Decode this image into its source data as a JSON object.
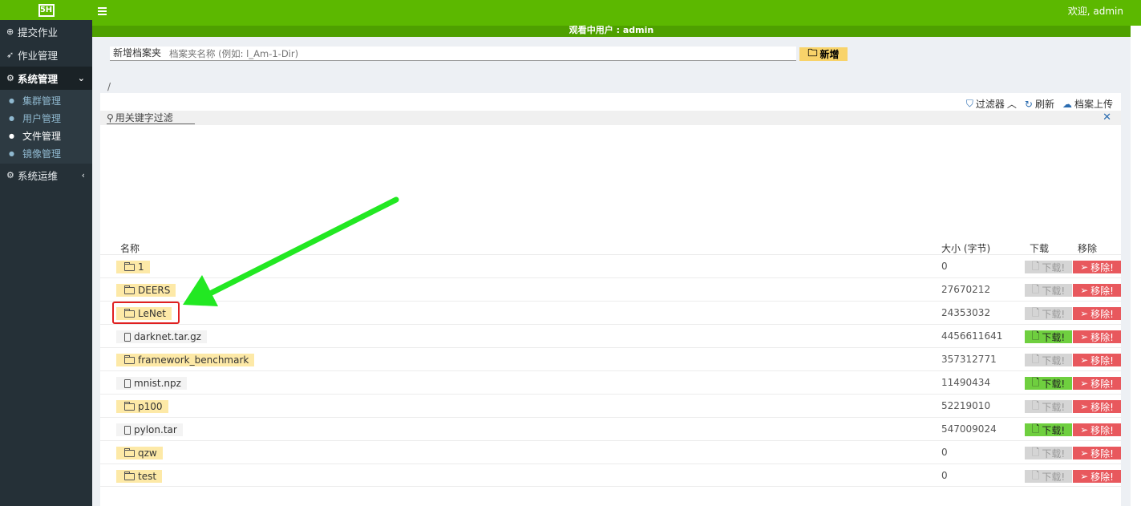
{
  "sidebar": {
    "logo": "5H",
    "items": [
      {
        "label": "提交作业",
        "icon": "plus-circle-icon"
      },
      {
        "label": "作业管理",
        "icon": "rocket-icon"
      },
      {
        "label": "系统管理",
        "icon": "gears-icon"
      },
      {
        "label": "系统运维",
        "icon": "gears-icon"
      }
    ],
    "submenu": [
      {
        "label": "集群管理"
      },
      {
        "label": "用户管理"
      },
      {
        "label": "文件管理"
      },
      {
        "label": "镜像管理"
      }
    ]
  },
  "topbar": {
    "welcome": "欢迎, admin",
    "viewing_user": "观看中用户 : admin"
  },
  "newdir": {
    "label": "新增档案夹",
    "placeholder": "档案夹名称 (例如: l_Am-1-Dir)",
    "button": "新增"
  },
  "path": "/",
  "toolbar": {
    "filter": "过滤器",
    "refresh": "刷新",
    "upload": "档案上传"
  },
  "filter": {
    "placeholder": "用关键字过滤"
  },
  "table": {
    "headers": {
      "name": "名称",
      "size": "大小 (字节)",
      "download": "下载",
      "remove": "移除"
    },
    "download_label": "下载!",
    "remove_label": "移除!",
    "rows": [
      {
        "name": "1",
        "type": "folder",
        "size": "0"
      },
      {
        "name": "DEERS",
        "type": "folder",
        "size": "27670212"
      },
      {
        "name": "LeNet",
        "type": "folder",
        "size": "24353032"
      },
      {
        "name": "darknet.tar.gz",
        "type": "file",
        "size": "4456611641"
      },
      {
        "name": "framework_benchmark",
        "type": "folder",
        "size": "357312771"
      },
      {
        "name": "mnist.npz",
        "type": "file",
        "size": "11490434"
      },
      {
        "name": "p100",
        "type": "folder",
        "size": "52219010"
      },
      {
        "name": "pylon.tar",
        "type": "file",
        "size": "547009024"
      },
      {
        "name": "qzw",
        "type": "folder",
        "size": "0"
      },
      {
        "name": "test",
        "type": "folder",
        "size": "0"
      }
    ]
  },
  "colors": {
    "brand_green": "#5cb800",
    "sidebar_bg": "#253037",
    "folder_chip": "#fde9a7",
    "download_on": "#6fcf3f",
    "remove": "#e8585d",
    "annotation_arrow": "#22e822",
    "annotation_box": "#e02020"
  }
}
